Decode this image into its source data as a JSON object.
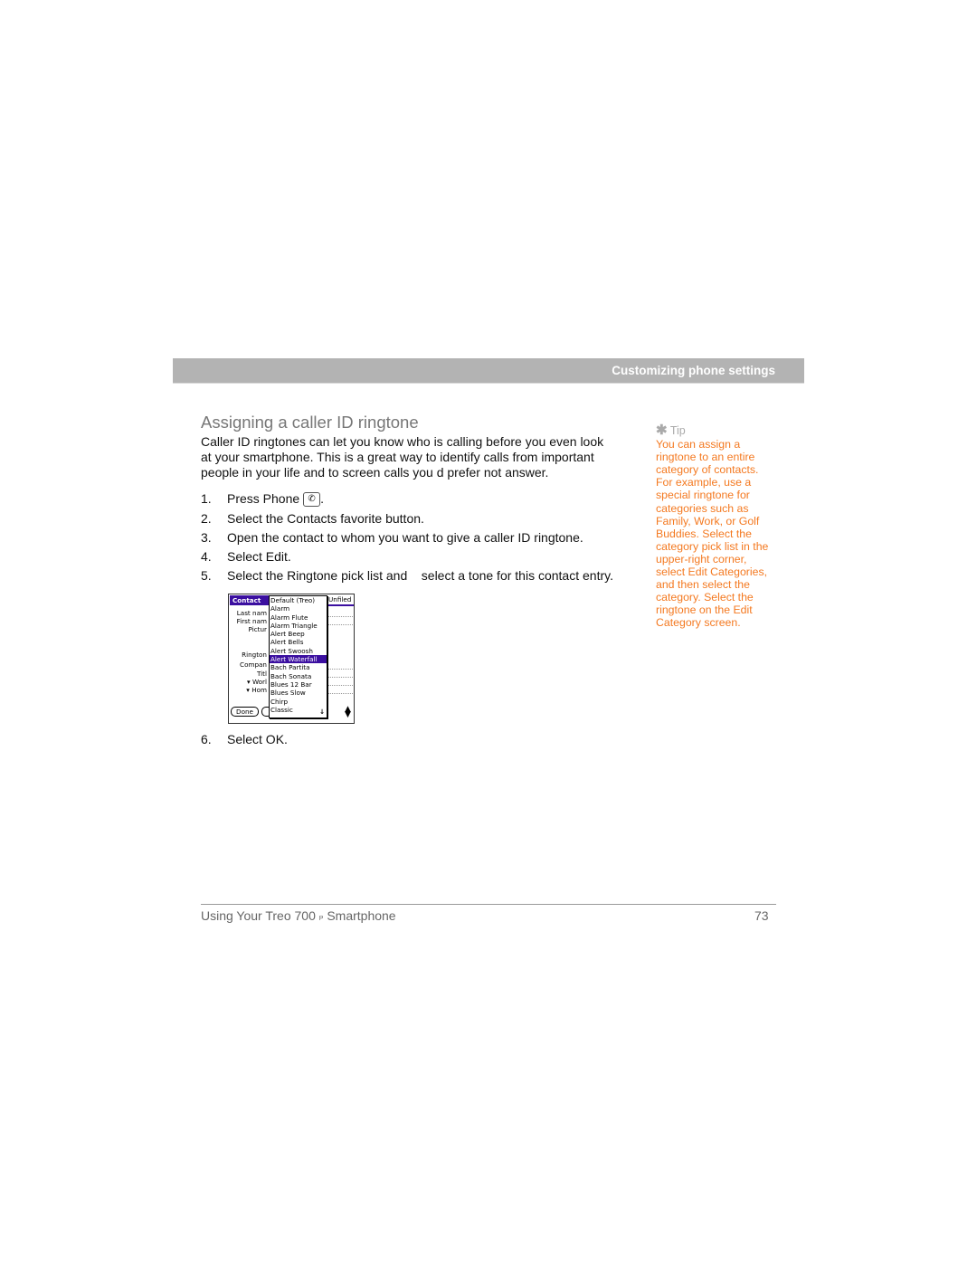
{
  "header": {
    "section": "Customizing phone settings"
  },
  "title": "Assigning a caller ID ringtone",
  "intro": "Caller ID ringtones can let you know who is calling before you even look at your smartphone. This is a great way to identify calls from important people in your life and to screen calls you d prefer not answer.",
  "steps": [
    {
      "num": "1.",
      "text": "Press Phone",
      "after": ".",
      "icon": "phone-key-icon"
    },
    {
      "num": "2.",
      "text": "Select the Contacts favorite button."
    },
    {
      "num": "3.",
      "text": "Open the contact to whom you want to give a caller ID ringtone."
    },
    {
      "num": "4.",
      "text": "Select Edit."
    },
    {
      "num": "5.",
      "text": "Select the Ringtone pick list and    select a tone for this contact entry."
    },
    {
      "num": "6.",
      "text": "Select OK."
    }
  ],
  "screen": {
    "title": "Contact",
    "category": "Unfiled",
    "fields": [
      "Last nam",
      "First nam",
      "Pictur",
      "Rington",
      "Compan",
      "Titl",
      "Worl",
      "Hom"
    ],
    "list": [
      "Default (Treo)",
      "Alarm",
      "Alarm Flute",
      "Alarm Triangle",
      "Alert Beep",
      "Alert Bells",
      "Alert Swoosh",
      "Alert Waterfall",
      "Bach Partita",
      "Bach Sonata",
      "Blues 12 Bar",
      "Blues Slow",
      "Chirp",
      "Classic"
    ],
    "selected": "Alert Waterfall",
    "done": "Done",
    "accent": "#3b0fa0"
  },
  "tip": {
    "label": "Tip",
    "icon": "asterisk-icon",
    "text": "You can assign a ringtone to an entire category of contacts. For example, use a special ringtone for categories such as Family, Work, or Golf Buddies. Select the category pick list in the upper-right corner, select Edit Categories, and then select the category. Select the ringtone on the Edit Category screen.",
    "color": "#f47920"
  },
  "footer": {
    "book": "Using Your Treo 700",
    "mark": "P",
    "suffix": "Smartphone",
    "page": "73"
  }
}
